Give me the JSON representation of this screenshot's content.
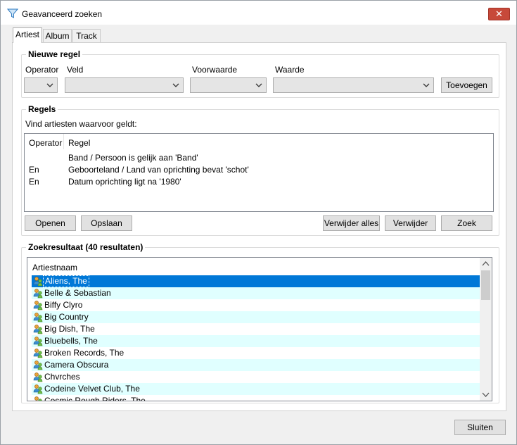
{
  "window": {
    "title": "Geavanceerd zoeken",
    "close_label": "✕"
  },
  "tabs": [
    {
      "label": "Artiest",
      "active": true
    },
    {
      "label": "Album",
      "active": false
    },
    {
      "label": "Track",
      "active": false
    }
  ],
  "new_rule": {
    "title": "Nieuwe regel",
    "operator_label": "Operator",
    "field_label": "Veld",
    "condition_label": "Voorwaarde",
    "value_label": "Waarde",
    "operator_value": "",
    "field_value": "",
    "condition_value": "",
    "value_value": "",
    "add_button": "Toevoegen"
  },
  "rules": {
    "title": "Regels",
    "description": "Vind artiesten waarvoor geldt:",
    "columns": {
      "operator": "Operator",
      "rule": "Regel"
    },
    "rows": [
      {
        "operator": "",
        "rule": "Band / Persoon is gelijk aan 'Band'"
      },
      {
        "operator": "En",
        "rule": "Geboorteland / Land van oprichting bevat 'schot'"
      },
      {
        "operator": "En",
        "rule": "Datum oprichting ligt na '1980'"
      }
    ],
    "buttons": {
      "open": "Openen",
      "save": "Opslaan",
      "delete_all": "Verwijder alles",
      "delete": "Verwijder",
      "search": "Zoek"
    }
  },
  "results": {
    "title": "Zoekresultaat (40 resultaten)",
    "column": "Artiestnaam",
    "rows": [
      {
        "name": "Aliens, The",
        "selected": true
      },
      {
        "name": "Belle & Sebastian"
      },
      {
        "name": "Biffy Clyro"
      },
      {
        "name": "Big Country"
      },
      {
        "name": "Big Dish, The"
      },
      {
        "name": "Bluebells, The"
      },
      {
        "name": "Broken Records, The"
      },
      {
        "name": "Camera Obscura"
      },
      {
        "name": "Chvrches"
      },
      {
        "name": "Codeine Velvet Club, The"
      },
      {
        "name": "Cosmic Rough Riders, The"
      }
    ]
  },
  "footer": {
    "close_button": "Sluiten"
  },
  "colors": {
    "selection": "#0078d7",
    "alt_row": "#e0ffff",
    "icon_band": "#3a8fd0",
    "icon_person": "#e8a33a"
  }
}
